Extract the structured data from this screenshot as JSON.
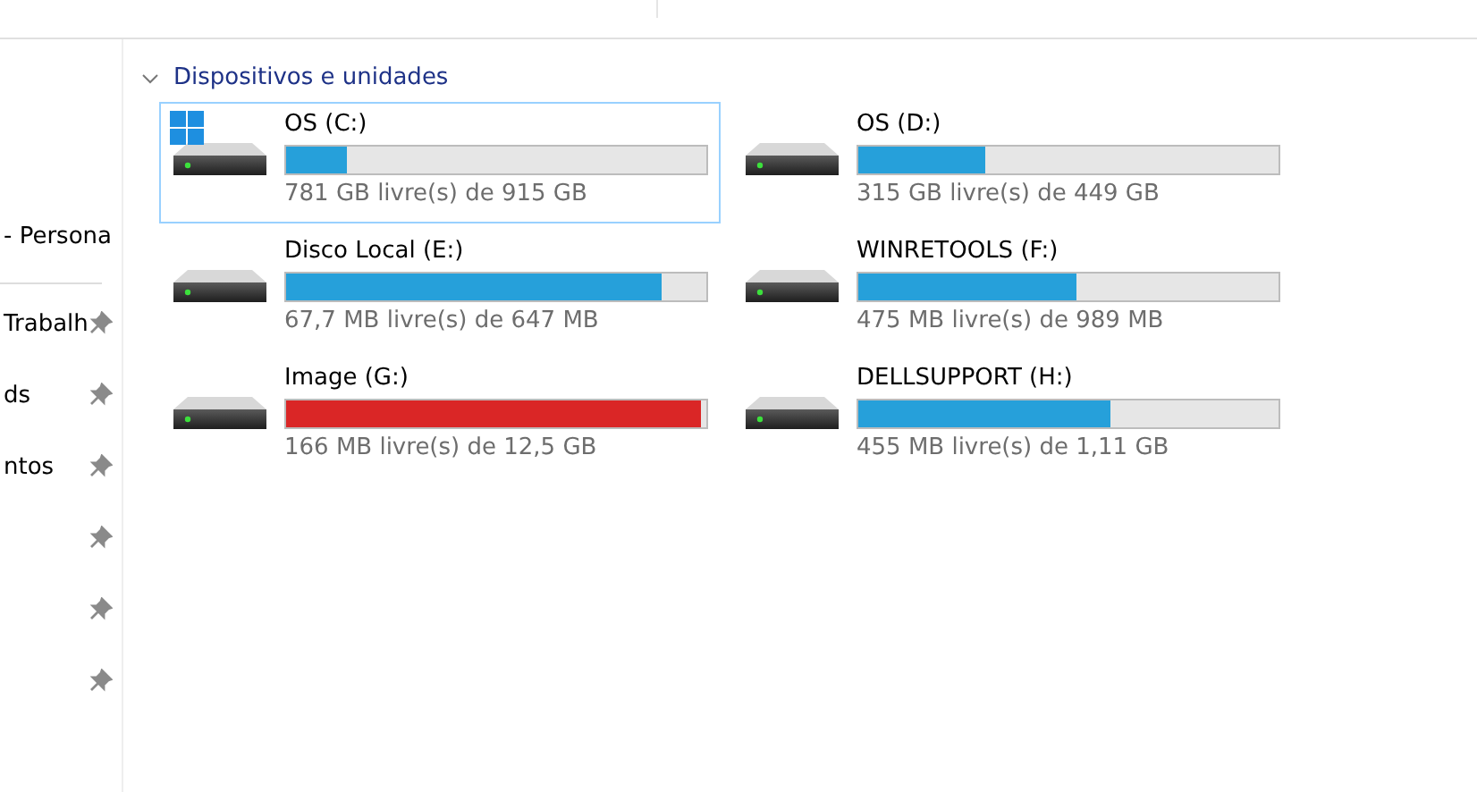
{
  "sidebar": {
    "items": [
      {
        "label": "- Persona",
        "pinned": false
      },
      {
        "label": "Trabalh",
        "pinned": true
      },
      {
        "label": "ds",
        "pinned": true
      },
      {
        "label": "ntos",
        "pinned": true
      },
      {
        "pinned": true
      },
      {
        "pinned": true
      },
      {
        "pinned": true
      }
    ]
  },
  "section": {
    "title": "Dispositivos e unidades",
    "expanded": true
  },
  "drives": [
    {
      "name": "OS (C:)",
      "system": true,
      "selected": true,
      "level": 0.146,
      "low_space": false,
      "info": "781 GB livre(s) de 915 GB"
    },
    {
      "name": "OS (D:)",
      "system": false,
      "selected": false,
      "level": 0.3,
      "low_space": false,
      "info": "315 GB livre(s) de 449 GB"
    },
    {
      "name": "Disco Local (E:)",
      "system": false,
      "selected": false,
      "level": 0.895,
      "low_space": false,
      "info": "67,7 MB livre(s) de 647 MB"
    },
    {
      "name": "WINRETOOLS (F:)",
      "system": false,
      "selected": false,
      "level": 0.52,
      "low_space": false,
      "info": "475 MB livre(s) de 989 MB"
    },
    {
      "name": "Image (G:)",
      "system": false,
      "selected": false,
      "level": 0.987,
      "low_space": true,
      "info": "166 MB livre(s) de 12,5 GB"
    },
    {
      "name": "DELLSUPPORT (H:)",
      "system": false,
      "selected": false,
      "level": 0.6,
      "low_space": false,
      "info": "455 MB livre(s) de 1,11 GB"
    }
  ]
}
